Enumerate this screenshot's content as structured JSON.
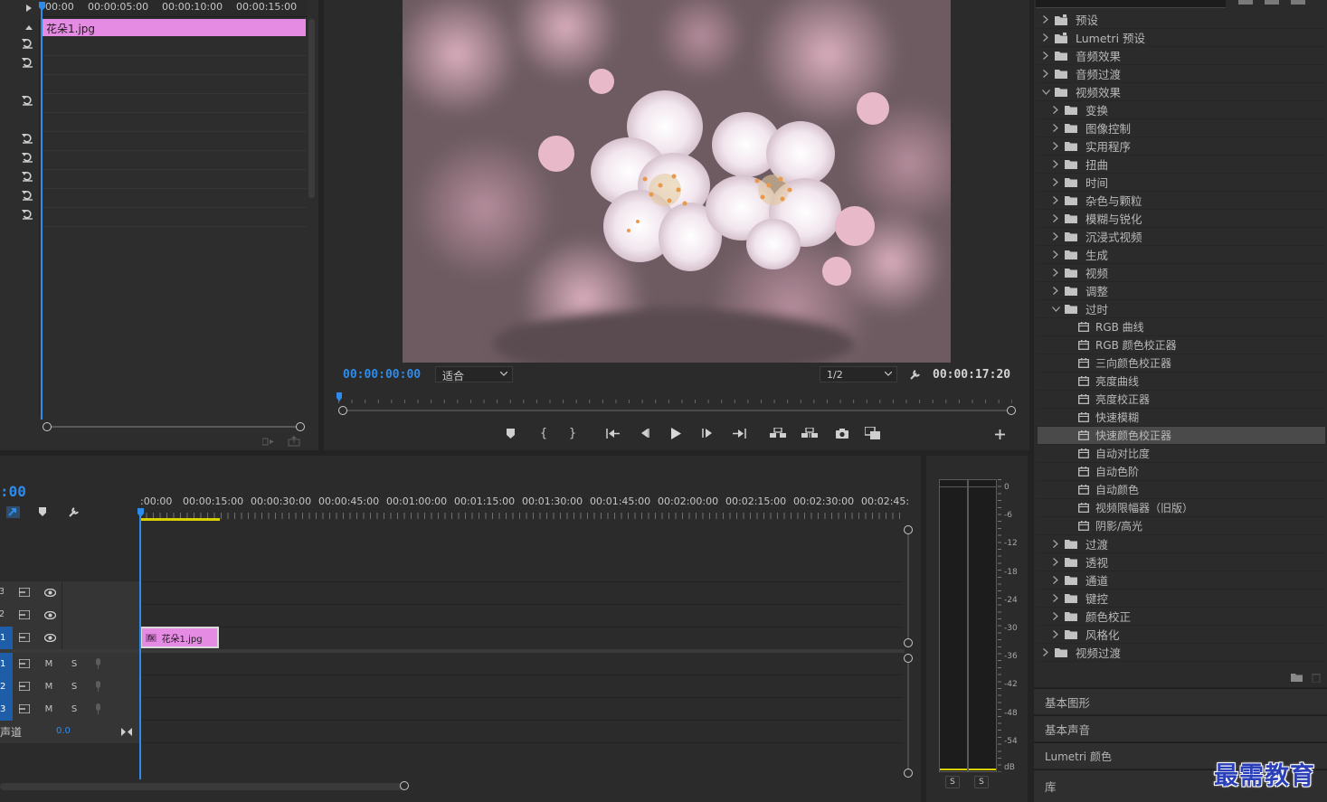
{
  "effect_controls": {
    "ruler": [
      "00:00",
      "00:00:05:00",
      "00:00:10:00",
      "00:00:15:00"
    ],
    "clip_name": "花朵1.jpg"
  },
  "program_monitor": {
    "timecode": "00:00:00:00",
    "fit_select": "适合",
    "resolution_select": "1/2",
    "duration": "00:00:17:20"
  },
  "timeline": {
    "timecode_partial": ":00",
    "ruler": [
      ":00:00",
      "00:00:15:00",
      "00:00:30:00",
      "00:00:45:00",
      "00:01:00:00",
      "00:01:15:00",
      "00:01:30:00",
      "00:01:45:00",
      "00:02:00:00",
      "00:02:15:00",
      "00:02:30:00",
      "00:02:45:"
    ],
    "clip_name": "花朵1.jpg",
    "clip_fx": "fx",
    "video_tracks": [
      "3",
      "2",
      "1"
    ],
    "audio_tracks": [
      {
        "num": "1",
        "mute": "M",
        "solo": "S"
      },
      {
        "num": "2",
        "mute": "M",
        "solo": "S"
      },
      {
        "num": "3",
        "mute": "M",
        "solo": "S"
      }
    ],
    "master_label": "声道",
    "master_value": "0.0"
  },
  "audio_meter": {
    "scale": [
      "0",
      "-6",
      "-12",
      "-18",
      "-24",
      "-30",
      "-36",
      "-42",
      "-48",
      "-54",
      "dB"
    ],
    "solo_left": "S",
    "solo_right": "S"
  },
  "effects_panel": {
    "items": [
      {
        "label": "预设",
        "level": 0,
        "kind": "preset-folder",
        "expanded": false
      },
      {
        "label": "Lumetri 预设",
        "level": 0,
        "kind": "preset-folder",
        "expanded": false
      },
      {
        "label": "音频效果",
        "level": 0,
        "kind": "folder",
        "expanded": false
      },
      {
        "label": "音频过渡",
        "level": 0,
        "kind": "folder",
        "expanded": false
      },
      {
        "label": "视频效果",
        "level": 0,
        "kind": "folder",
        "expanded": true
      },
      {
        "label": "变换",
        "level": 1,
        "kind": "folder",
        "expanded": false
      },
      {
        "label": "图像控制",
        "level": 1,
        "kind": "folder",
        "expanded": false
      },
      {
        "label": "实用程序",
        "level": 1,
        "kind": "folder",
        "expanded": false
      },
      {
        "label": "扭曲",
        "level": 1,
        "kind": "folder",
        "expanded": false
      },
      {
        "label": "时间",
        "level": 1,
        "kind": "folder",
        "expanded": false
      },
      {
        "label": "杂色与颗粒",
        "level": 1,
        "kind": "folder",
        "expanded": false
      },
      {
        "label": "模糊与锐化",
        "level": 1,
        "kind": "folder",
        "expanded": false
      },
      {
        "label": "沉浸式视频",
        "level": 1,
        "kind": "folder",
        "expanded": false
      },
      {
        "label": "生成",
        "level": 1,
        "kind": "folder",
        "expanded": false
      },
      {
        "label": "视频",
        "level": 1,
        "kind": "folder",
        "expanded": false
      },
      {
        "label": "调整",
        "level": 1,
        "kind": "folder",
        "expanded": false
      },
      {
        "label": "过时",
        "level": 1,
        "kind": "folder",
        "expanded": true
      },
      {
        "label": "RGB 曲线",
        "level": 2,
        "kind": "effect"
      },
      {
        "label": "RGB 颜色校正器",
        "level": 2,
        "kind": "effect"
      },
      {
        "label": "三向颜色校正器",
        "level": 2,
        "kind": "effect"
      },
      {
        "label": "亮度曲线",
        "level": 2,
        "kind": "effect"
      },
      {
        "label": "亮度校正器",
        "level": 2,
        "kind": "effect"
      },
      {
        "label": "快速模糊",
        "level": 2,
        "kind": "effect"
      },
      {
        "label": "快速颜色校正器",
        "level": 2,
        "kind": "effect",
        "selected": true
      },
      {
        "label": "自动对比度",
        "level": 2,
        "kind": "effect"
      },
      {
        "label": "自动色阶",
        "level": 2,
        "kind": "effect"
      },
      {
        "label": "自动颜色",
        "level": 2,
        "kind": "effect"
      },
      {
        "label": "视频限幅器（旧版）",
        "level": 2,
        "kind": "effect"
      },
      {
        "label": "阴影/高光",
        "level": 2,
        "kind": "effect"
      },
      {
        "label": "过渡",
        "level": 1,
        "kind": "folder",
        "expanded": false
      },
      {
        "label": "透视",
        "level": 1,
        "kind": "folder",
        "expanded": false
      },
      {
        "label": "通道",
        "level": 1,
        "kind": "folder",
        "expanded": false
      },
      {
        "label": "键控",
        "level": 1,
        "kind": "folder",
        "expanded": false
      },
      {
        "label": "颜色校正",
        "level": 1,
        "kind": "folder",
        "expanded": false
      },
      {
        "label": "风格化",
        "level": 1,
        "kind": "folder",
        "expanded": false
      },
      {
        "label": "视频过渡",
        "level": 0,
        "kind": "folder",
        "expanded": false
      }
    ],
    "collapsed_panels": [
      "基本图形",
      "基本声音",
      "Lumetri 颜色",
      "库"
    ]
  },
  "watermark": "最需教育",
  "colors": {
    "accent_blue": "#2d8ceb",
    "clip_pink": "#e58be3",
    "work_area_yellow": "#d8d000",
    "selection": "#4a4a4a"
  }
}
